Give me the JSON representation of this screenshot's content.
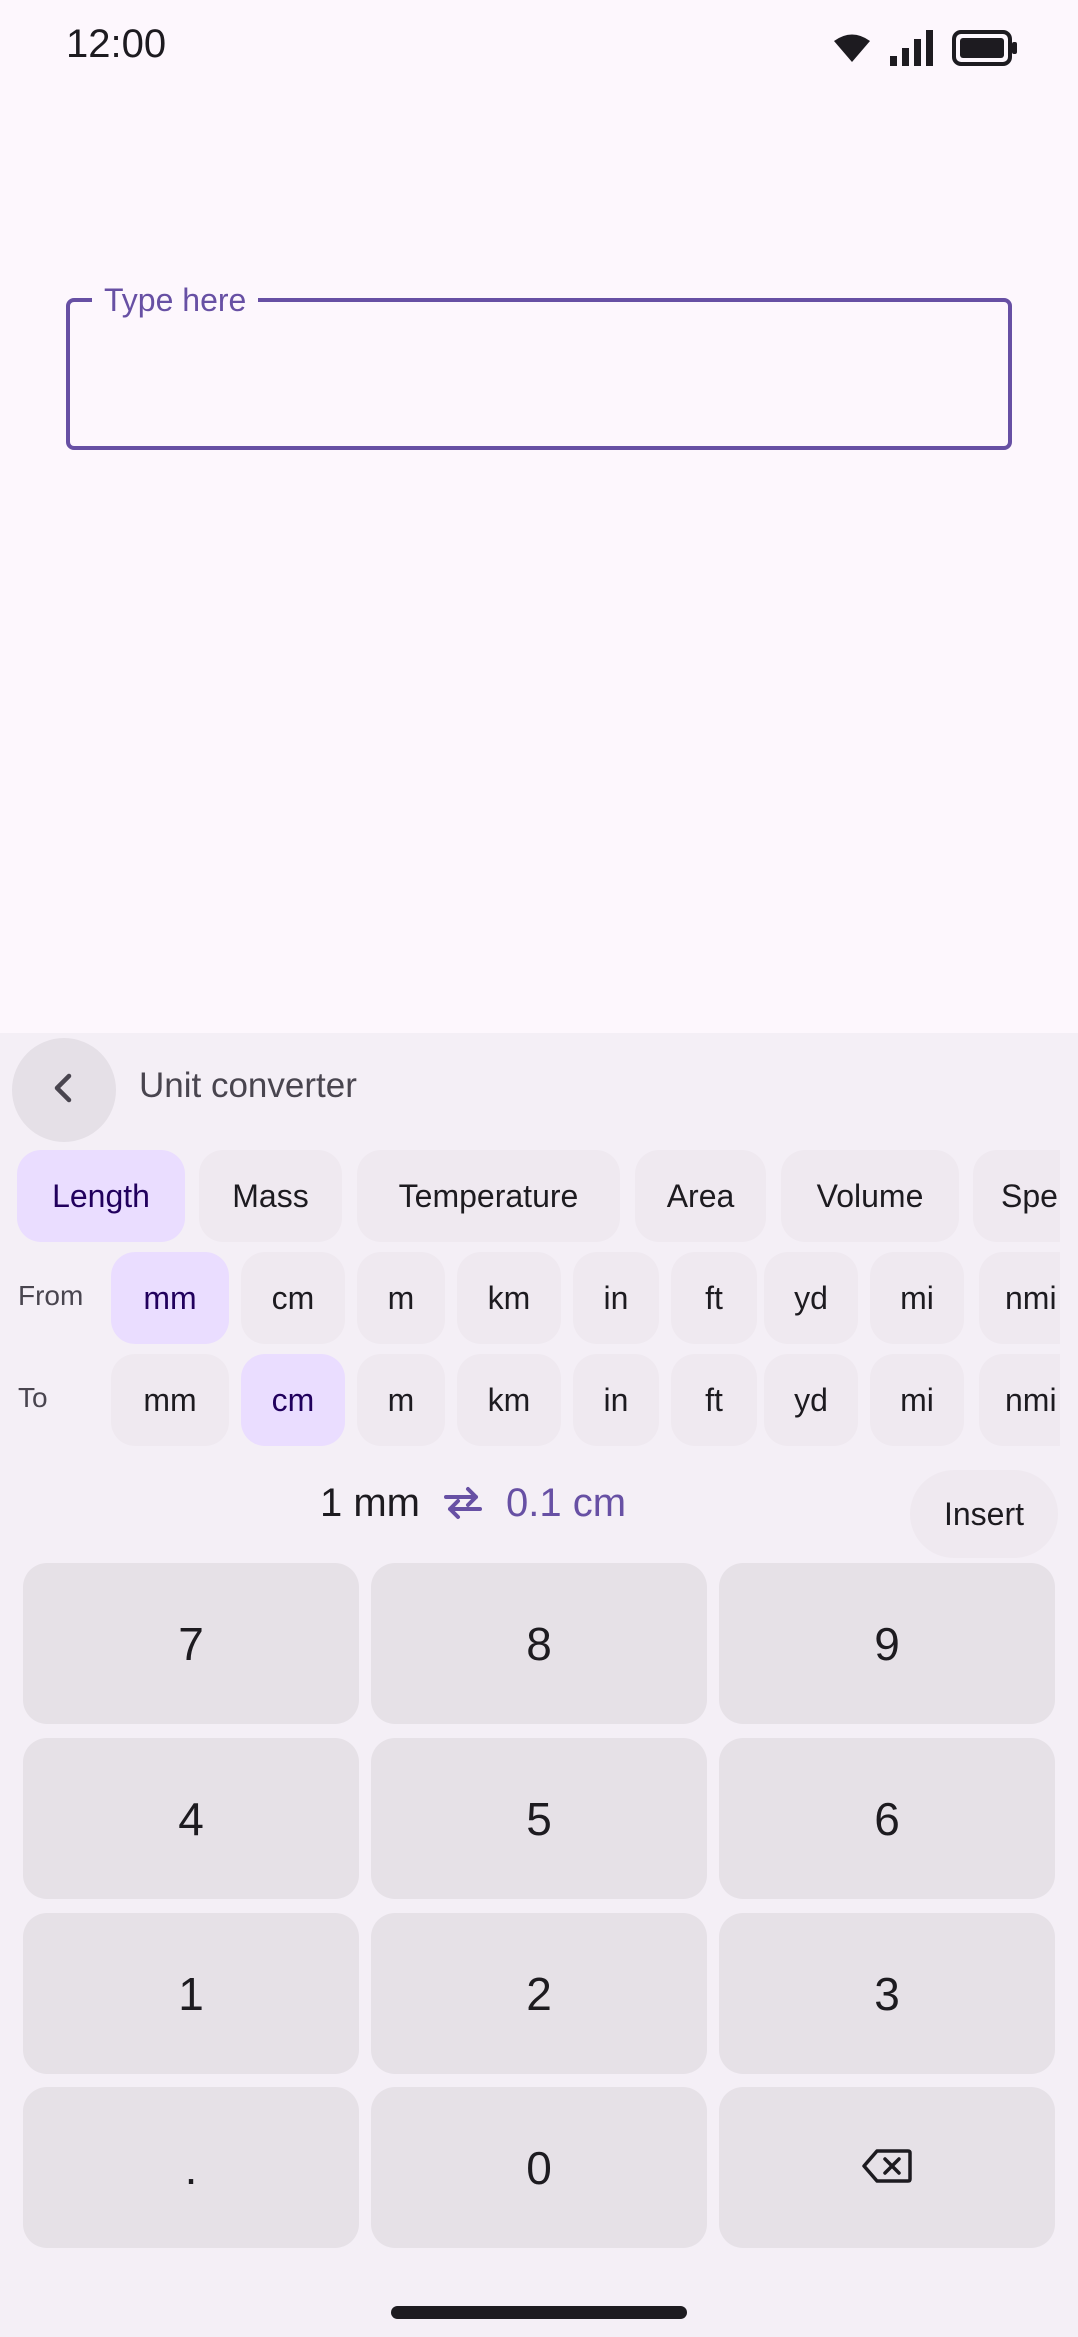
{
  "status_bar": {
    "time": "12:00",
    "icons": [
      "wifi-icon",
      "signal-icon",
      "battery-icon"
    ]
  },
  "text_field": {
    "label": "Type here",
    "value": ""
  },
  "converter": {
    "title": "Unit converter",
    "categories": [
      {
        "label": "Length",
        "selected": true
      },
      {
        "label": "Mass",
        "selected": false
      },
      {
        "label": "Temperature",
        "selected": false
      },
      {
        "label": "Area",
        "selected": false
      },
      {
        "label": "Volume",
        "selected": false
      },
      {
        "label": "Spe",
        "selected": false
      }
    ],
    "from_label": "From",
    "to_label": "To",
    "from_units": [
      "mm",
      "cm",
      "m",
      "km",
      "in",
      "ft",
      "yd",
      "mi",
      "nmi"
    ],
    "to_units": [
      "mm",
      "cm",
      "m",
      "km",
      "in",
      "ft",
      "yd",
      "mi",
      "nmi"
    ],
    "from_selected": "mm",
    "to_selected": "cm",
    "result_from": "1 mm",
    "result_to": "0.1 cm",
    "insert_label": "Insert"
  },
  "keypad": {
    "keys": [
      "7",
      "8",
      "9",
      "4",
      "5",
      "6",
      "1",
      "2",
      "3",
      ".",
      "0",
      "backspace-icon"
    ]
  },
  "colors": {
    "accent": "#6750a4",
    "chip_selected": "#eaddff",
    "panel_bg": "#f4eff6",
    "key_bg": "#e6e1e7"
  }
}
